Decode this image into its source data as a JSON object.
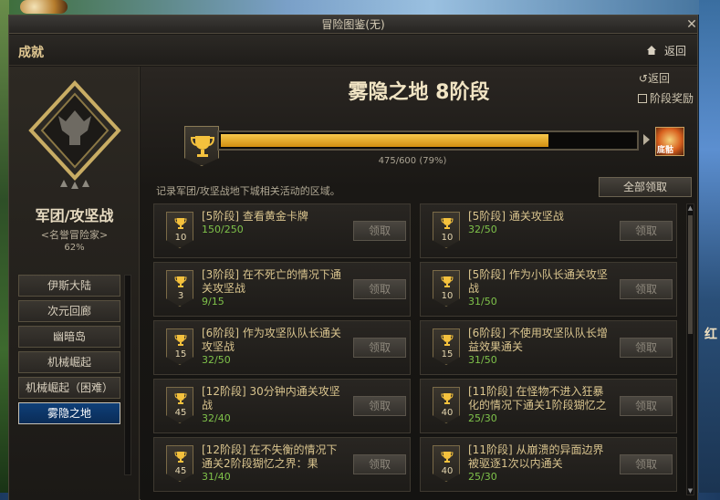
{
  "window": {
    "title": "冒险图鉴(无)",
    "close": "✕"
  },
  "header": {
    "title": "成就",
    "back_label": "返回"
  },
  "left_panel": {
    "dungeon_name": "军团/攻坚战",
    "rank_name": "<名誉冒险家>",
    "rank_percent": "62%",
    "stages": [
      {
        "label": "伊斯大陆",
        "active": false
      },
      {
        "label": "次元回廊",
        "active": false
      },
      {
        "label": "幽暗岛",
        "active": false
      },
      {
        "label": "机械崛起",
        "active": false
      },
      {
        "label": "机械崛起（困难）",
        "active": false
      },
      {
        "label": "雾隐之地",
        "active": true
      }
    ]
  },
  "main": {
    "title": "雾隐之地 8阶段",
    "back_label": "返回",
    "reward_label": "阶段奖励",
    "progress": {
      "current": 475,
      "total": 600,
      "fraction": 0.79,
      "text": "475/600 (79%)"
    },
    "reward_badge_text": "底骷",
    "description": "记录军团/攻坚战地下城相关活动的区域。",
    "claim_all_label": "全部领取",
    "achievements": [
      {
        "title": "[5阶段] 查看黄金卡牌",
        "progress": "150/250",
        "points": "10",
        "button": "领取"
      },
      {
        "title": "[5阶段] 通关攻坚战",
        "progress": "32/50",
        "points": "10",
        "button": "领取"
      },
      {
        "title": "[3阶段] 在不死亡的情况下通关攻坚战",
        "progress": "9/15",
        "points": "3",
        "button": "领取"
      },
      {
        "title": "[5阶段] 作为小队长通关攻坚战",
        "progress": "31/50",
        "points": "10",
        "button": "领取"
      },
      {
        "title": "[6阶段] 作为攻坚队队长通关攻坚战",
        "progress": "32/50",
        "points": "15",
        "button": "领取"
      },
      {
        "title": "[6阶段] 不使用攻坚队队长增益效果通关",
        "progress": "31/50",
        "points": "15",
        "button": "领取"
      },
      {
        "title": "[12阶段] 30分钟内通关攻坚战",
        "progress": "32/40",
        "points": "45",
        "button": "领取"
      },
      {
        "title": "[11阶段] 在怪物不进入狂暴化的情况下通关1阶段猢忆之",
        "progress": "25/30",
        "points": "40",
        "button": "领取"
      },
      {
        "title": "[12阶段] 在不失衡的情况下通关2阶段猢忆之界：果",
        "progress": "31/40",
        "points": "45",
        "button": "领取"
      },
      {
        "title": "[11阶段] 从崩溃的异面边界被驱逐1次以内通关",
        "progress": "25/30",
        "points": "40",
        "button": "领取"
      }
    ]
  },
  "background": {
    "side_text": "红"
  },
  "colors": {
    "accent_gold": "#f6c74b",
    "progress_green": "#7fc24a",
    "active_tab": "#0f3f78"
  }
}
